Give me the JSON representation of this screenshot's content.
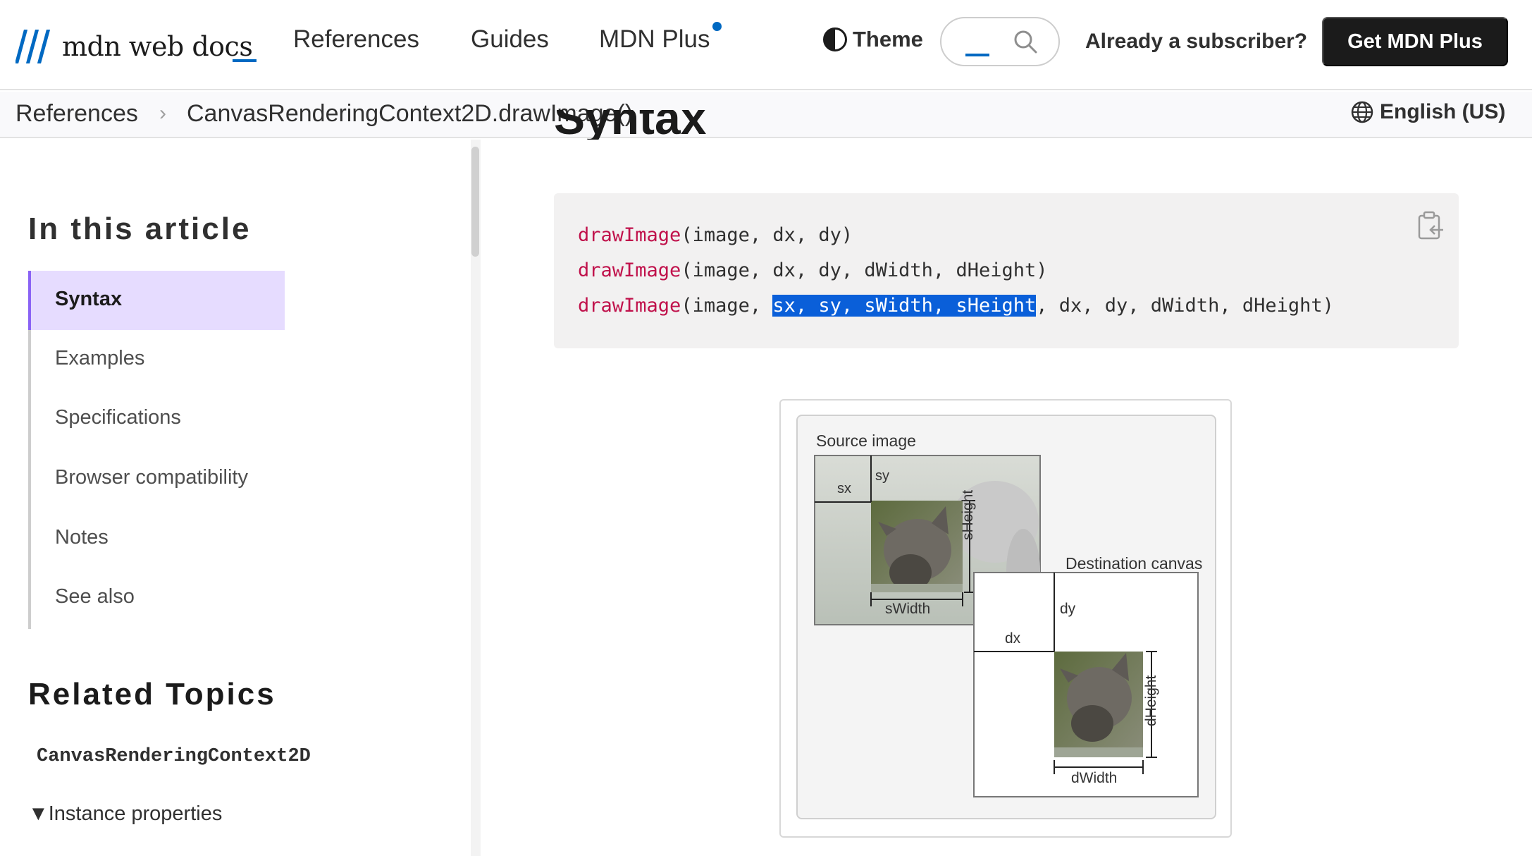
{
  "header": {
    "logo_text": "mdn web docs",
    "nav": [
      "References",
      "Guides",
      "MDN Plus"
    ],
    "theme_label": "Theme",
    "subscriber_label": "Already a subscriber?",
    "cta_label": "Get MDN Plus"
  },
  "breadcrumb": {
    "items": [
      "References",
      "CanvasRenderingContext2D.drawImage()"
    ],
    "separator": "›"
  },
  "language": "English (US)",
  "toc": {
    "title": "In this article",
    "items": [
      "Syntax",
      "Examples",
      "Specifications",
      "Browser compatibility",
      "Notes",
      "See also"
    ],
    "active_index": 0
  },
  "related": {
    "title": "Related Topics",
    "link": "CanvasRenderingContext2D",
    "group": "Instance properties"
  },
  "main": {
    "heading": "Syntax",
    "code": {
      "fn": "drawImage",
      "line1_args": "(image, dx, dy)",
      "line2_args": "(image, dx, dy, dWidth, dHeight)",
      "line3_pre": "(image, ",
      "line3_highlight": "sx, sy, sWidth, sHeight",
      "line3_post": ", dx, dy, dWidth, dHeight)"
    },
    "figure": {
      "source_label": "Source image",
      "dest_label": "Destination canvas",
      "labels": {
        "sx": "sx",
        "sy": "sy",
        "sWidth": "sWidth",
        "sHeight": "sHeight",
        "dx": "dx",
        "dy": "dy",
        "dWidth": "dWidth",
        "dHeight": "dHeight"
      }
    }
  },
  "colors": {
    "brand_blue": "#0069c2",
    "code_function": "#c0114b",
    "selection": "#0a5fd9",
    "toc_active_bg": "#e6dcff",
    "toc_active_border": "#8a63f5"
  }
}
